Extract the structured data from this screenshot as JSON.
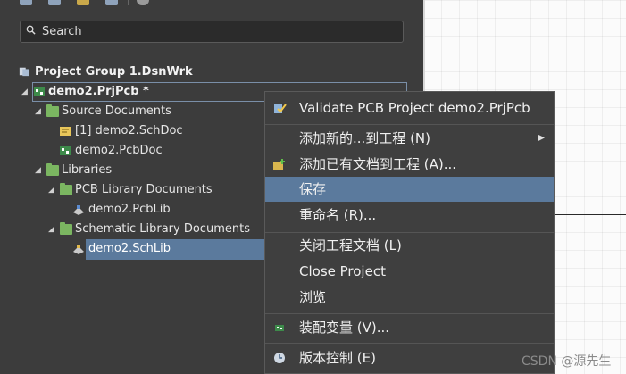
{
  "search": {
    "placeholder": "Search"
  },
  "tree": {
    "group": "Project Group 1.DsnWrk",
    "project": "demo2.PrjPcb *",
    "source_documents": "Source Documents",
    "schdoc": "[1] demo2.SchDoc",
    "pcbdoc": "demo2.PcbDoc",
    "libraries": "Libraries",
    "pcb_library_documents": "PCB Library Documents",
    "pcblib": "demo2.PcbLib",
    "schematic_library_documents": "Schematic Library Documents",
    "schlib": "demo2.SchLib"
  },
  "menu": {
    "items": [
      {
        "label": "Validate PCB Project demo2.PrjPcb"
      },
      {
        "label": "添加新的...到工程 (N)"
      },
      {
        "label": "添加已有文档到工程 (A)..."
      },
      {
        "label": "保存"
      },
      {
        "label": "重命名 (R)..."
      },
      {
        "label": "关闭工程文档 (L)"
      },
      {
        "label": "Close Project"
      },
      {
        "label": "浏览"
      },
      {
        "label": "装配变量 (V)..."
      },
      {
        "label": "版本控制 (E)"
      }
    ]
  },
  "watermark": "CSDN @源先生",
  "colors": {
    "panel_bg": "#3c3c3c",
    "selection": "#5b7a9d",
    "canvas_bg": "#fbfbfb"
  }
}
